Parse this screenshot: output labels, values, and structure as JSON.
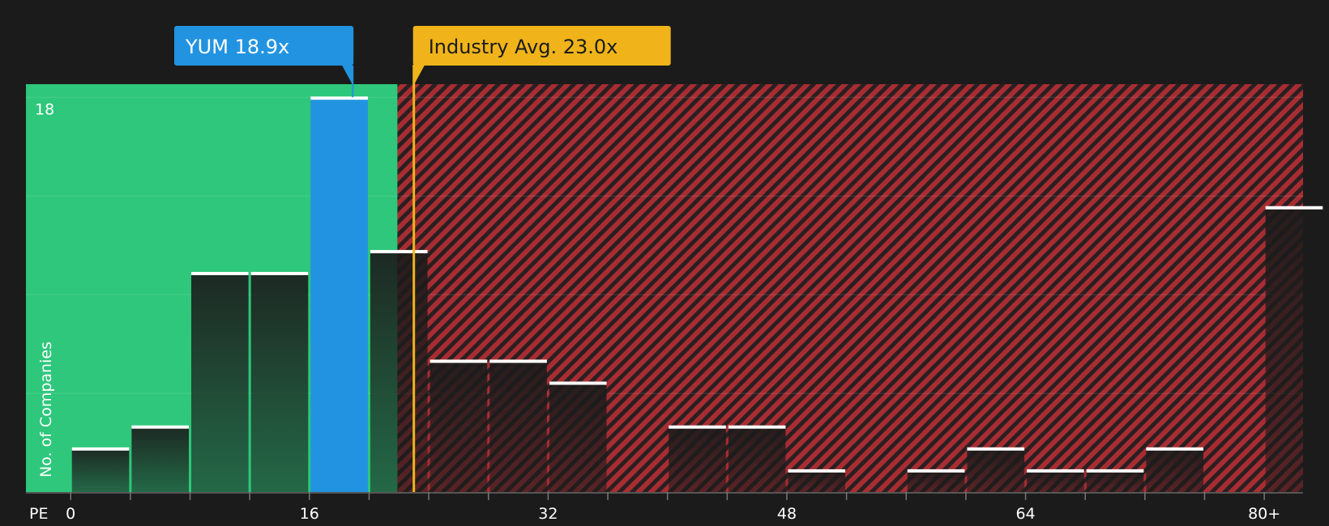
{
  "chart_data": {
    "type": "bar",
    "title": "",
    "xlabel": "PE",
    "ylabel": "No. of Companies",
    "bin_width": 4,
    "xlim": [
      -3,
      82.6
    ],
    "ylim": [
      0,
      18.6
    ],
    "y_tick_label": "18",
    "x_ticks": [
      {
        "value": 0,
        "label": "0"
      },
      {
        "value": 16,
        "label": "16"
      },
      {
        "value": 32,
        "label": "32"
      },
      {
        "value": 48,
        "label": "48"
      },
      {
        "value": 64,
        "label": "64"
      },
      {
        "value": 80,
        "label": "80+"
      }
    ],
    "bins": [
      {
        "start": 0,
        "count": 2
      },
      {
        "start": 4,
        "count": 3
      },
      {
        "start": 8,
        "count": 10
      },
      {
        "start": 12,
        "count": 10
      },
      {
        "start": 16,
        "count": 18,
        "highlight": true
      },
      {
        "start": 20,
        "count": 11
      },
      {
        "start": 24,
        "count": 6
      },
      {
        "start": 28,
        "count": 6
      },
      {
        "start": 32,
        "count": 5
      },
      {
        "start": 40,
        "count": 3
      },
      {
        "start": 44,
        "count": 3
      },
      {
        "start": 48,
        "count": 1
      },
      {
        "start": 56,
        "count": 1
      },
      {
        "start": 60,
        "count": 2
      },
      {
        "start": 64,
        "count": 1
      },
      {
        "start": 68,
        "count": 1
      },
      {
        "start": 72,
        "count": 2
      },
      {
        "start": 80,
        "count": 13
      }
    ],
    "fair_zone_end": 21.9,
    "company": {
      "label": "YUM 18.9x",
      "value": 18.9
    },
    "industry": {
      "label": "Industry Avg. 23.0x",
      "value": 23.0
    },
    "colors": {
      "background": "#1b1b1b",
      "fair_zone": "#2ec77b",
      "over_zone": "#a72d33",
      "highlight_bar": "#2293e0",
      "company_callout": "#2293e0",
      "industry_callout": "#f0b41a",
      "bar_cap": "#ffffff"
    }
  }
}
